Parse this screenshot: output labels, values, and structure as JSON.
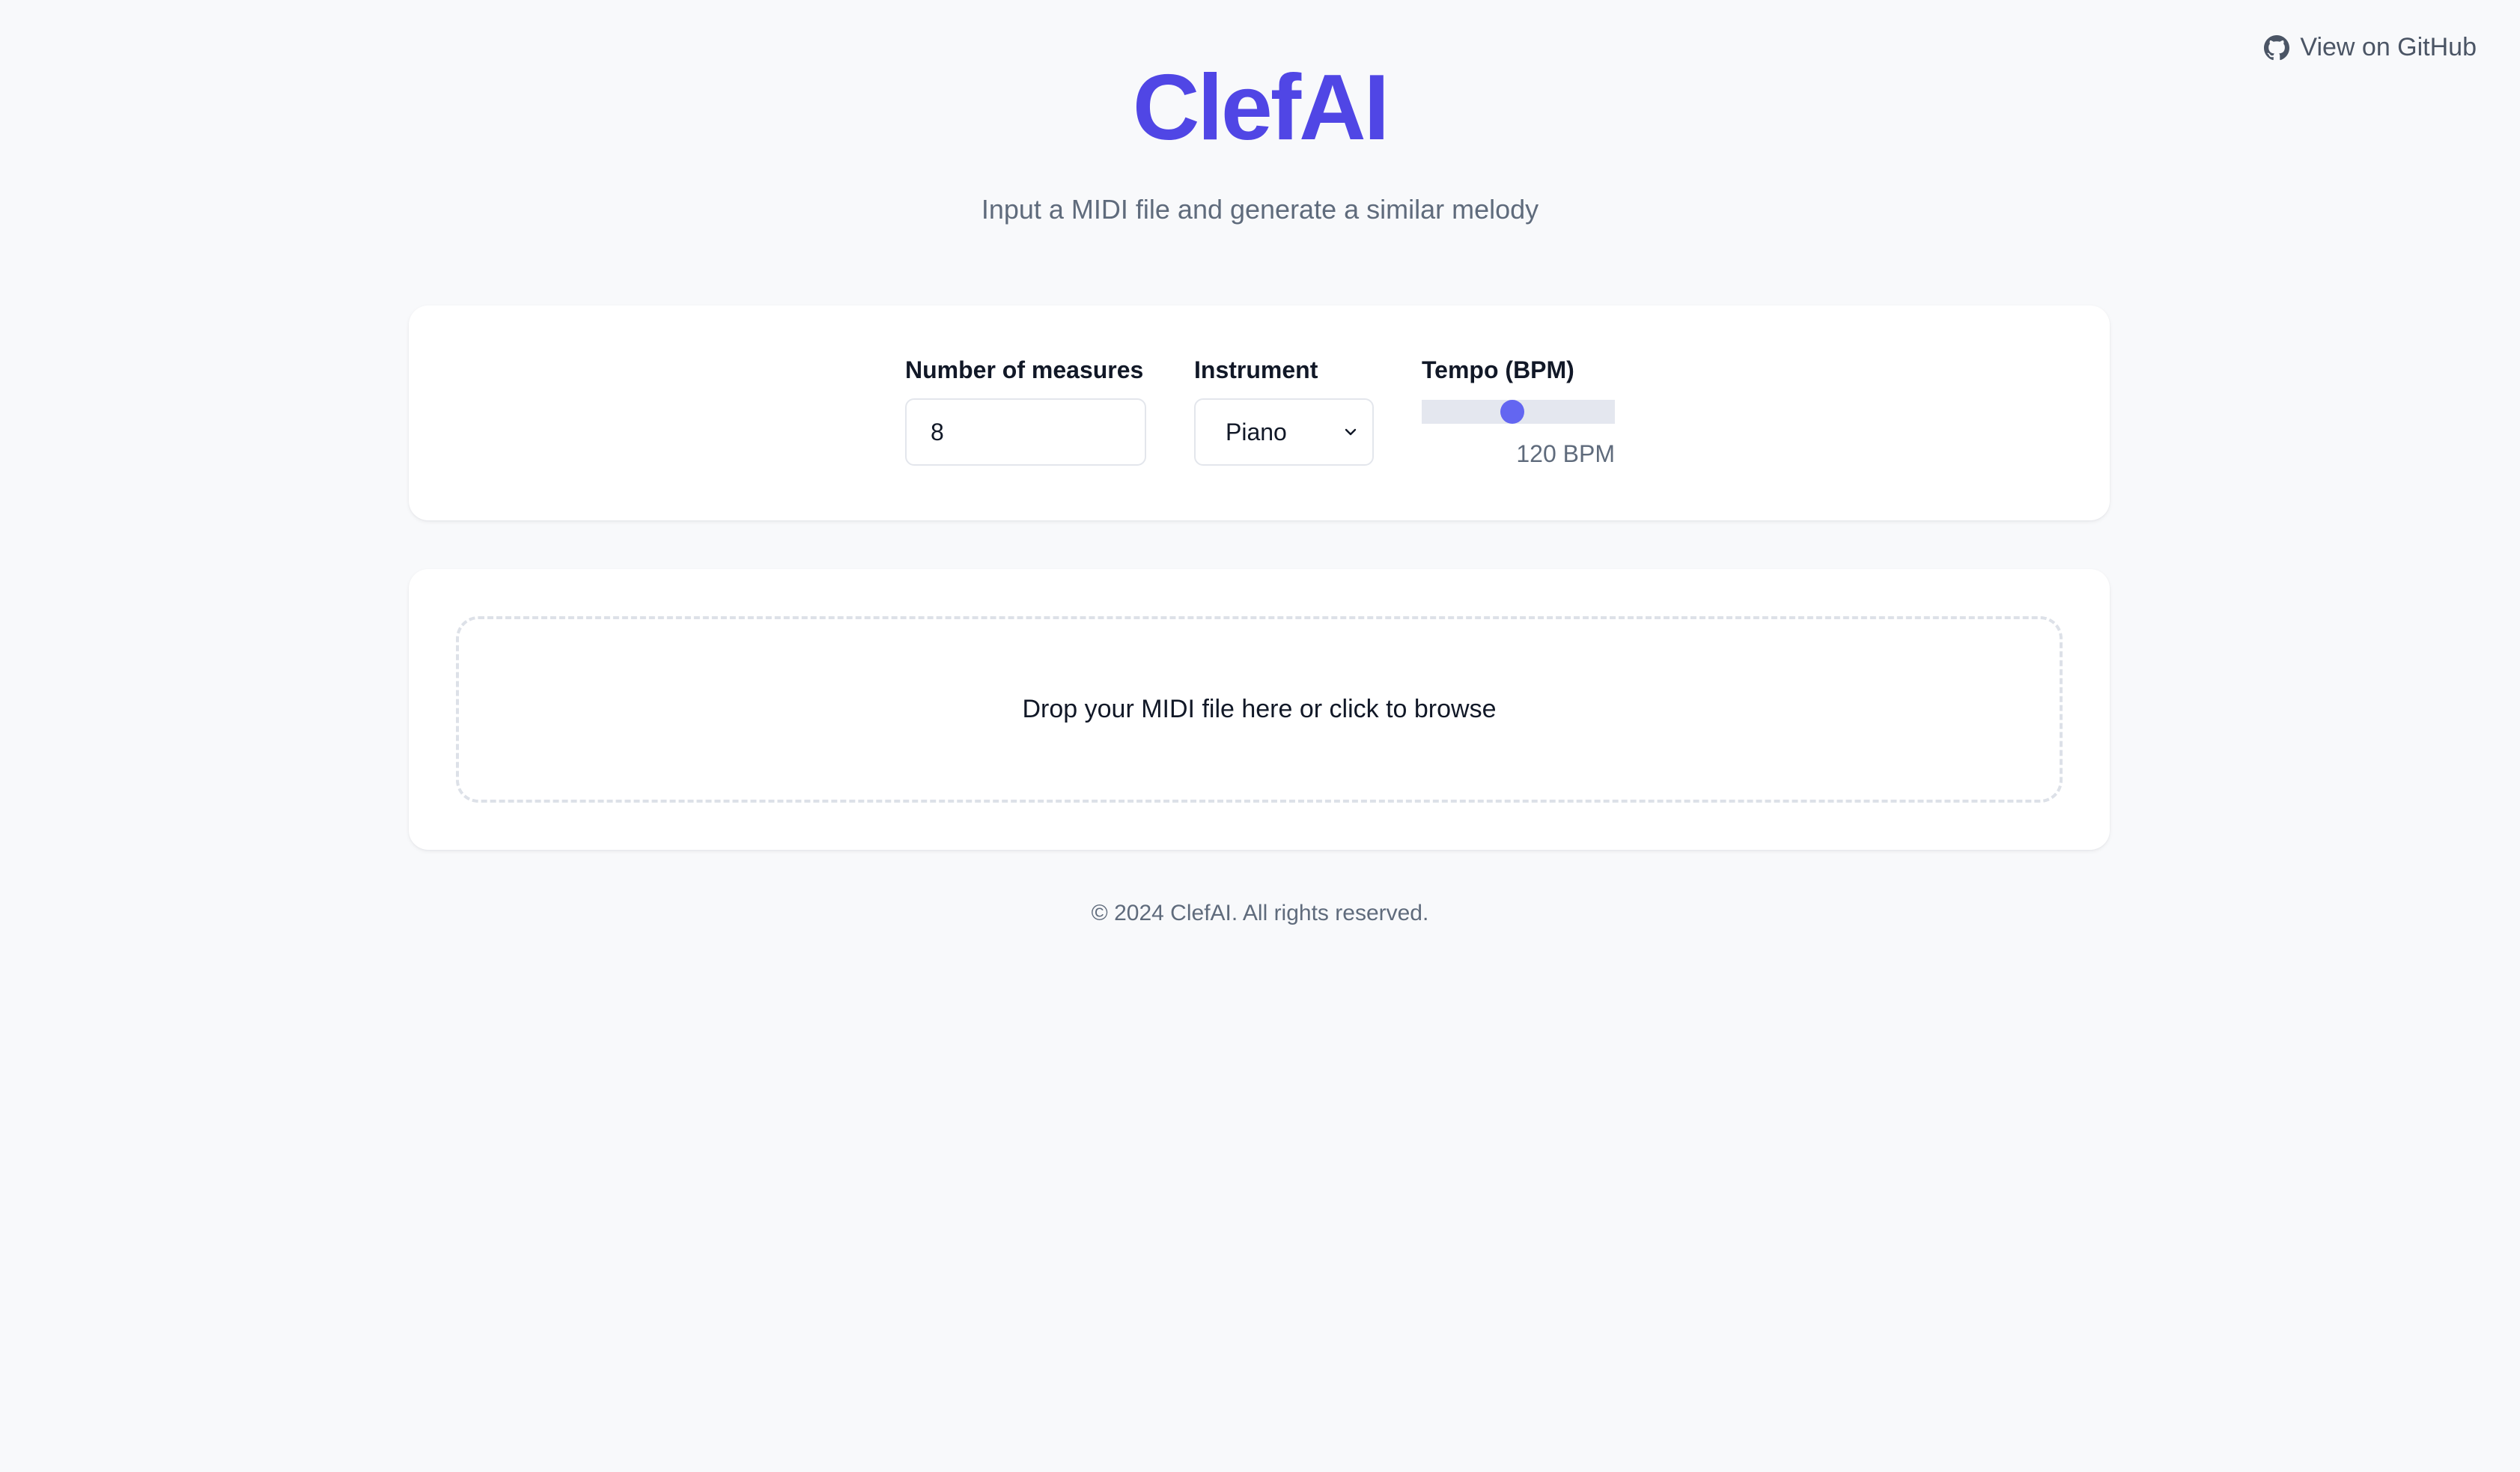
{
  "github": {
    "label": "View on GitHub",
    "icon": "github-icon"
  },
  "header": {
    "title": "ClefAI",
    "subtitle": "Input a MIDI file and generate a similar melody"
  },
  "settings": {
    "measures": {
      "label": "Number of measures",
      "value": "8"
    },
    "instrument": {
      "label": "Instrument",
      "selected": "Piano",
      "icon": "chevron-down-icon"
    },
    "tempo": {
      "label": "Tempo (BPM)",
      "value": 120,
      "value_text": "120 BPM",
      "fill_fraction": 0.47
    }
  },
  "upload": {
    "prompt": "Drop your MIDI file here or click to browse"
  },
  "footer": {
    "copyright": "© 2024 ClefAI. All rights reserved."
  },
  "colors": {
    "accent": "#5046e5",
    "slider_thumb": "#6366f1",
    "background": "#f8f9fb",
    "muted_text": "#5f6b7c"
  }
}
